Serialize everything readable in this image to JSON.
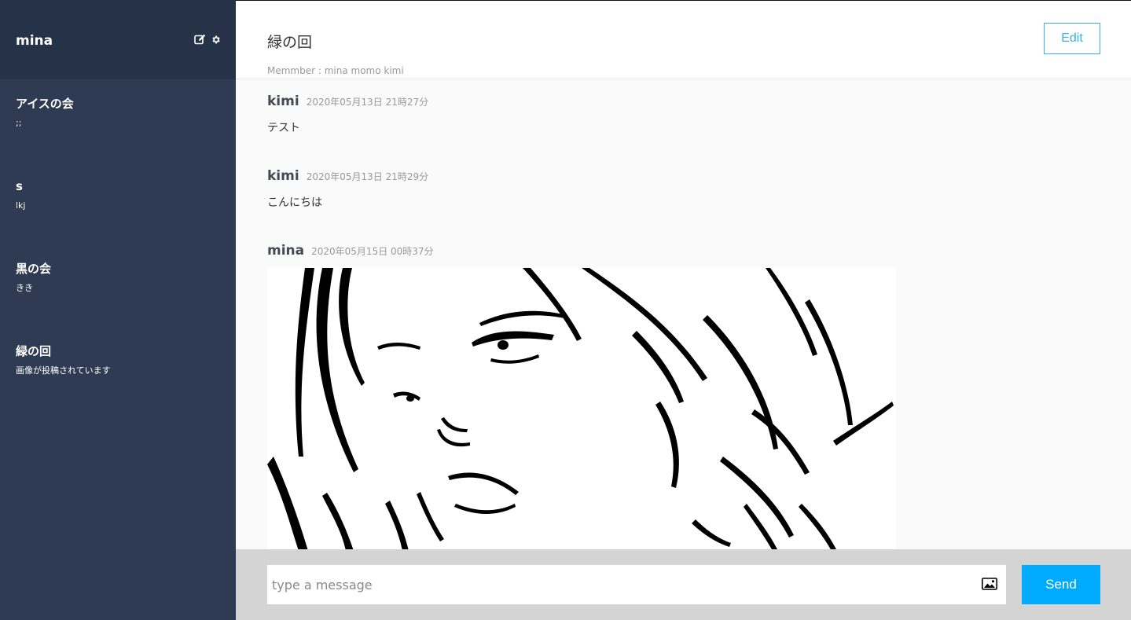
{
  "sidebar": {
    "user_name": "mina",
    "icons": [
      "edit-icon",
      "gear-icon"
    ],
    "groups": [
      {
        "name": "アイスの会",
        "last_message": ";;"
      },
      {
        "name": "s",
        "last_message": "lkj"
      },
      {
        "name": "黒の会",
        "last_message": "きき"
      },
      {
        "name": "緑の回",
        "last_message": "画像が投稿されています"
      }
    ]
  },
  "header": {
    "room_title": "緑の回",
    "members": "Memmber : mina momo kimi",
    "edit_label": "Edit"
  },
  "messages": [
    {
      "user": "kimi",
      "date": "2020年05月13日 21時27分",
      "text": "テスト"
    },
    {
      "user": "kimi",
      "date": "2020年05月13日 21時29分",
      "text": "こんにちは"
    },
    {
      "user": "mina",
      "date": "2020年05月15日 00時37分",
      "image": "line-art-portrait"
    }
  ],
  "footer": {
    "placeholder": "type a message",
    "send_label": "Send",
    "image_icon": "image-icon"
  },
  "colors": {
    "sidebar_bg": "#2e3b52",
    "sidebar_header_bg": "#253247",
    "accent": "#38aef0",
    "send_bg": "#00aaff",
    "footer_bg": "#d4d4d4"
  }
}
